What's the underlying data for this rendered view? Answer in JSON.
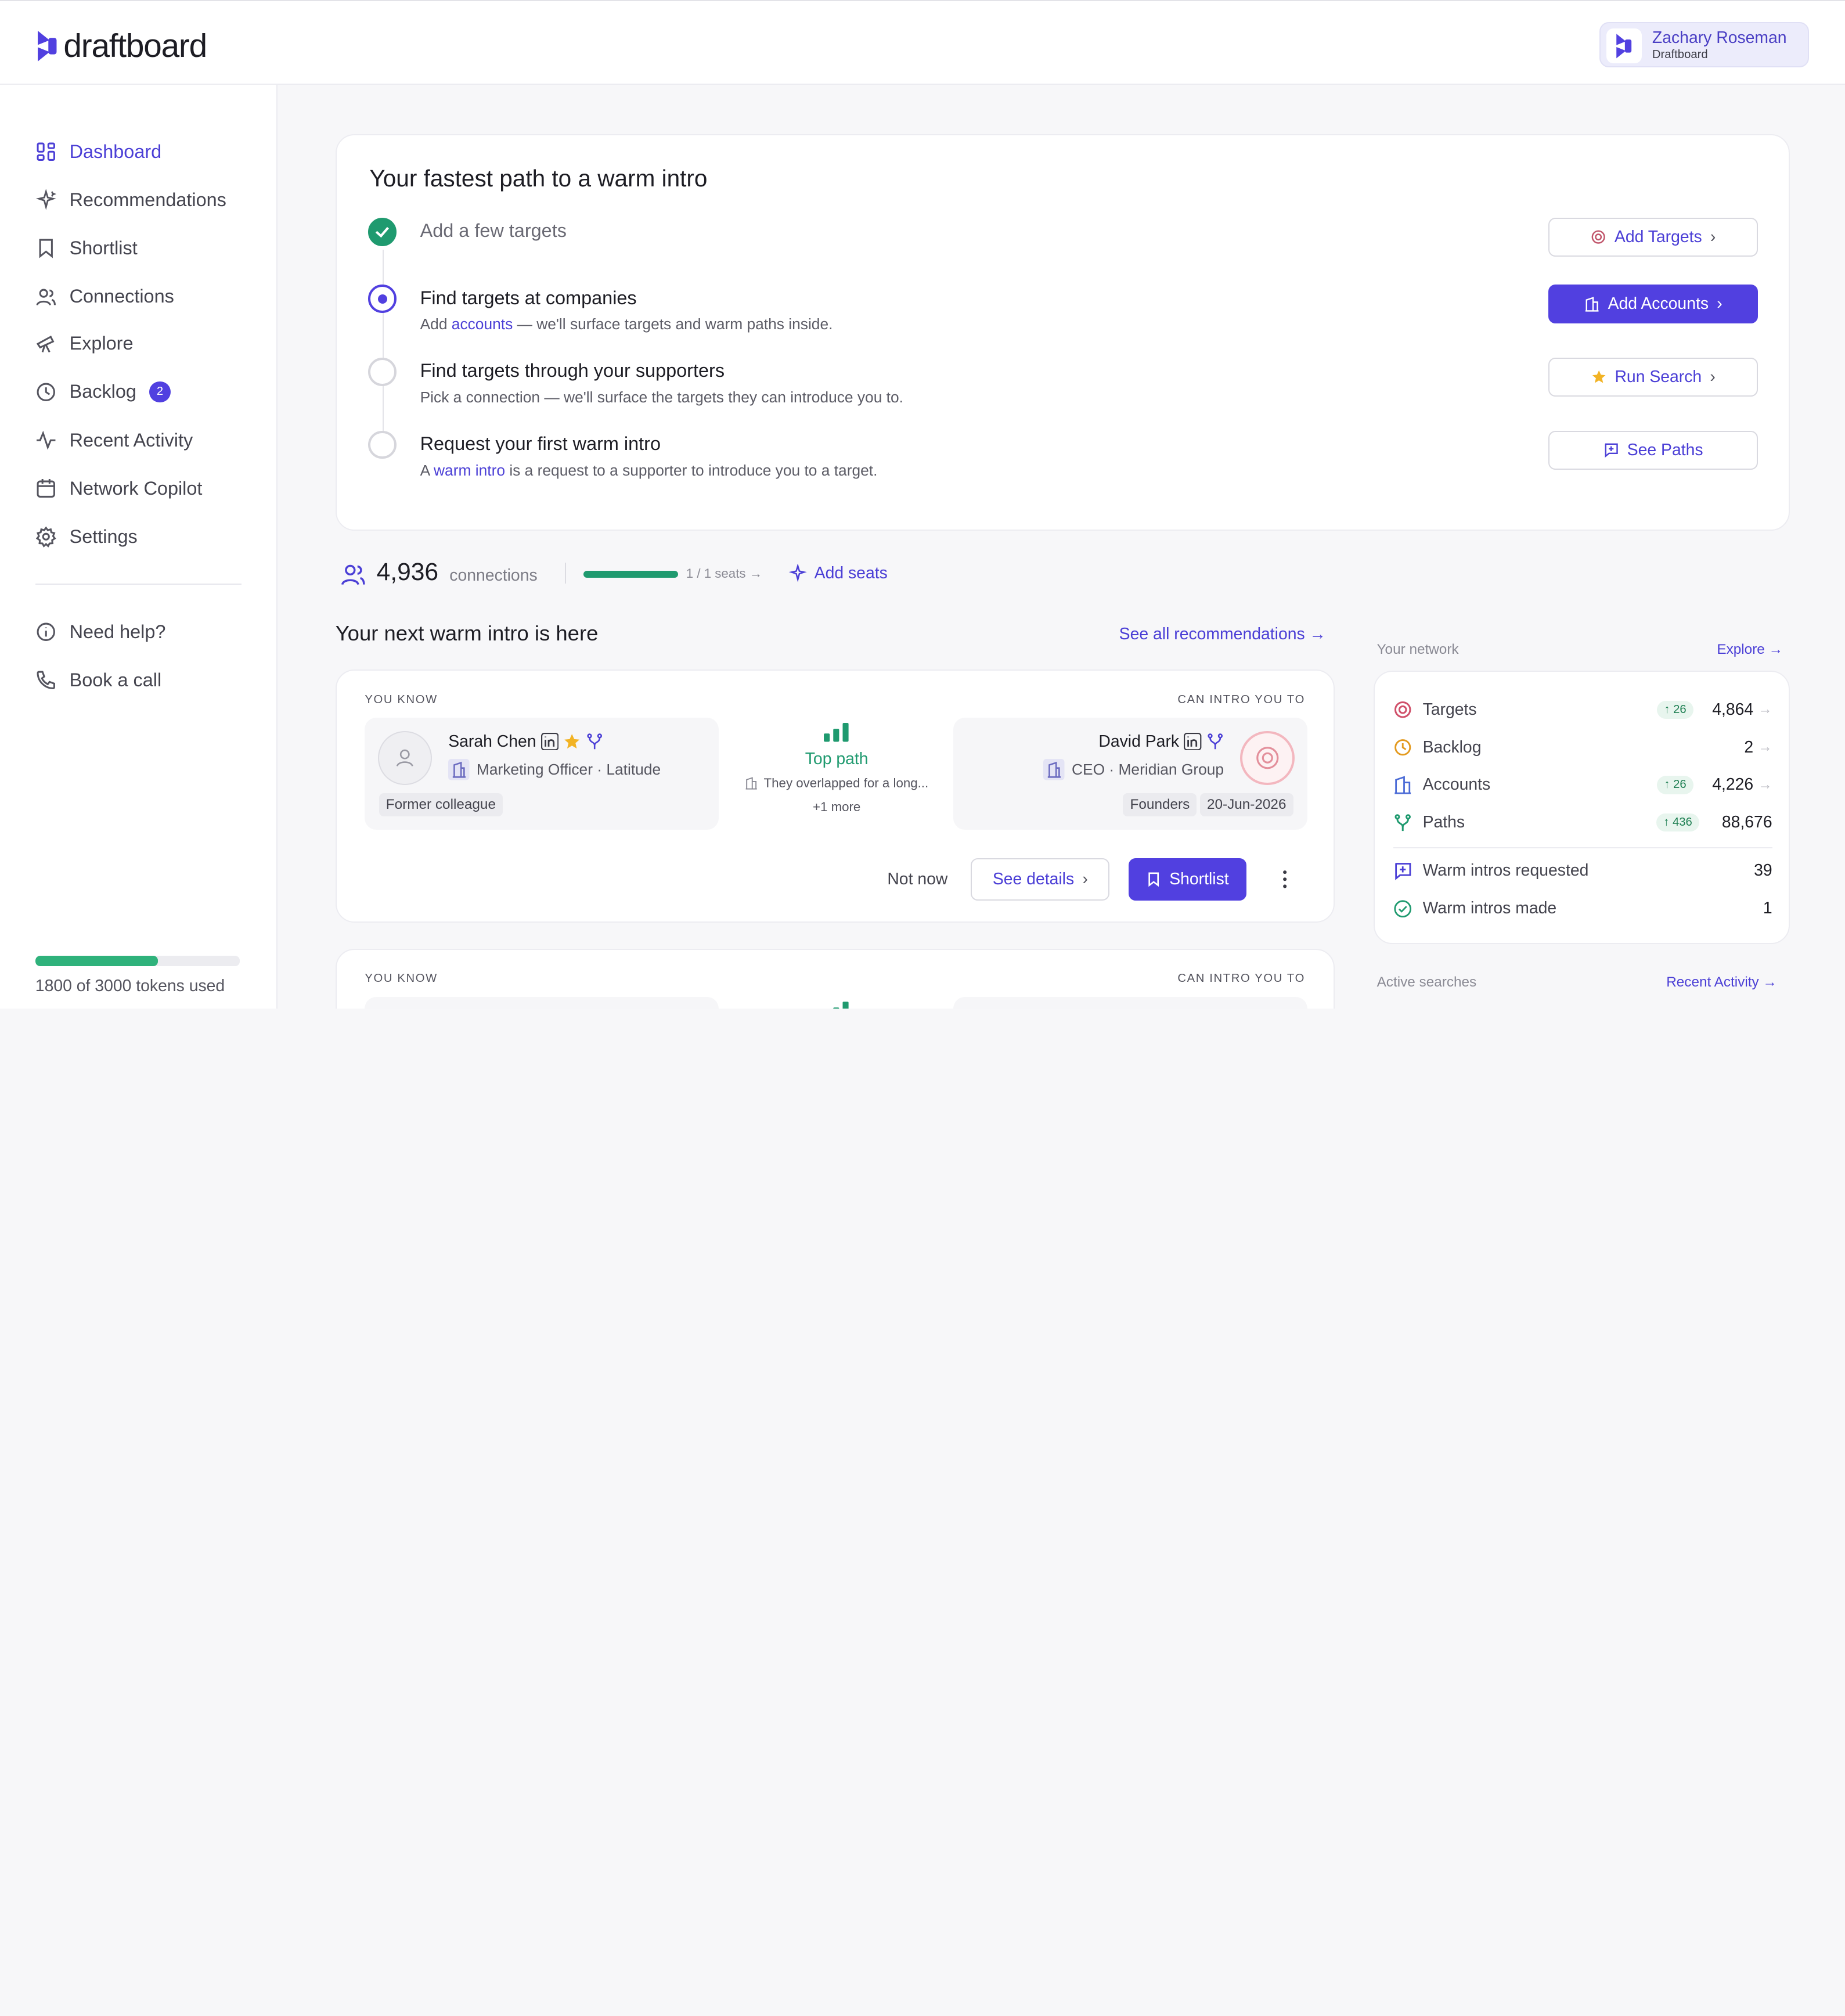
{
  "brand": {
    "name": "draftboard",
    "accent": "#5140e0",
    "success": "#1f9a6f"
  },
  "user": {
    "name": "Zachary Roseman",
    "org": "Draftboard"
  },
  "sidebar": {
    "items": [
      {
        "label": "Dashboard",
        "icon": "dashboard-icon",
        "active": true
      },
      {
        "label": "Recommendations",
        "icon": "sparkles-icon"
      },
      {
        "label": "Shortlist",
        "icon": "bookmark-icon"
      },
      {
        "label": "Connections",
        "icon": "users-icon"
      },
      {
        "label": "Explore",
        "icon": "telescope-icon"
      },
      {
        "label": "Backlog",
        "icon": "clock-icon",
        "badge": "2"
      },
      {
        "label": "Recent Activity",
        "icon": "activity-icon"
      },
      {
        "label": "Network Copilot",
        "icon": "calendar-icon"
      },
      {
        "label": "Settings",
        "icon": "gear-icon"
      }
    ],
    "help": [
      {
        "label": "Need help?",
        "icon": "info-icon"
      },
      {
        "label": "Book a call",
        "icon": "phone-icon"
      }
    ],
    "tokens": {
      "text": "1800 of 3000 tokens used",
      "used": 1800,
      "total": 3000
    }
  },
  "hero": {
    "title": "Your fastest path to a warm intro",
    "steps": [
      {
        "title": "Add a few targets",
        "state": "done",
        "button": "Add Targets"
      },
      {
        "title": "Find targets at companies",
        "state": "current",
        "desc_pre": "Add ",
        "desc_link": "accounts",
        "desc_post": " — we'll surface targets and warm paths inside.",
        "button": "Add Accounts"
      },
      {
        "title": "Find targets through your supporters",
        "state": "todo",
        "desc": "Pick a connection — we'll surface the targets they can introduce you to.",
        "button": "Run Search"
      },
      {
        "title": "Request your first warm intro",
        "state": "todo",
        "desc_pre": "A ",
        "desc_link": "warm intro",
        "desc_post": " is a request to a supporter to introduce you to a target.",
        "button": "See Paths"
      }
    ]
  },
  "connections": {
    "count": "4,936",
    "label": "connections",
    "seats_text": "1 / 1 seats →",
    "seats_fraction": 1.0,
    "add_seats": "Add seats"
  },
  "recommendations": {
    "title": "Your next warm intro is here",
    "see_all": "See all recommendations →",
    "you_know_label": "YOU KNOW",
    "can_intro_label": "CAN INTRO YOU TO",
    "card": {
      "left": {
        "name": "Sarah Chen",
        "role": "Marketing Officer · Latitude",
        "chip": "Former colleague"
      },
      "path": {
        "title": "Top path",
        "desc": "They overlapped for a long...",
        "more": "+1 more"
      },
      "right": {
        "name": "David Park",
        "role": "CEO · Meridian Group",
        "chips": [
          "Founders",
          "20-Jun-2026"
        ]
      },
      "actions": {
        "not_now": "Not now",
        "details": "See details",
        "shortlist": "Shortlist"
      }
    }
  },
  "network": {
    "label": "Your network",
    "explore": "Explore →",
    "rows": [
      {
        "label": "Targets",
        "icon": "target-icon",
        "delta": "26",
        "value": "4,864"
      },
      {
        "label": "Backlog",
        "icon": "clock-icon",
        "value": "2"
      },
      {
        "label": "Accounts",
        "icon": "building-icon",
        "delta": "26",
        "value": "4,226"
      },
      {
        "label": "Paths",
        "icon": "fork-icon",
        "delta": "436",
        "value": "88,676"
      }
    ],
    "stats": [
      {
        "label": "Warm intros requested",
        "icon": "message-plus-icon",
        "value": "39"
      },
      {
        "label": "Warm intros made",
        "icon": "check-circle-icon",
        "value": "1"
      }
    ],
    "active_label": "Active searches",
    "recent_link": "Recent Activity →"
  }
}
